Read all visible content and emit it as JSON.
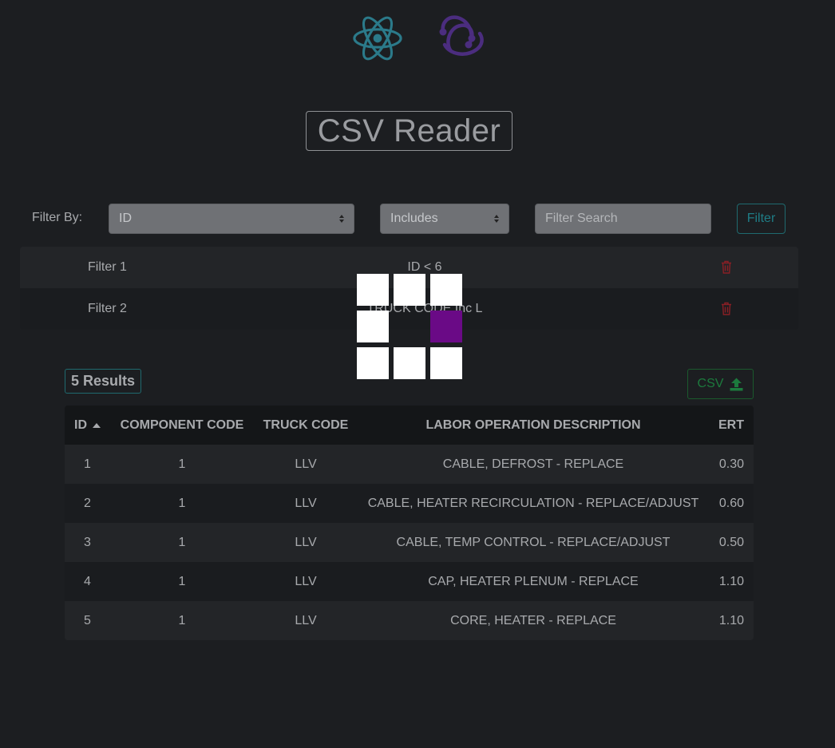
{
  "header": {
    "title": "CSV Reader",
    "logos": [
      "react-logo",
      "redux-logo"
    ]
  },
  "filter_bar": {
    "label": "Filter By:",
    "field_select": {
      "selected": "ID"
    },
    "operator_select": {
      "selected": "Includes"
    },
    "search": {
      "value": "",
      "placeholder": "Filter Search"
    },
    "button_label": "Filter"
  },
  "active_filters": [
    {
      "name": "Filter 1",
      "expression": "ID < 6"
    },
    {
      "name": "Filter 2",
      "expression": "TRUCK CODE Inc L"
    }
  ],
  "results": {
    "count_label": "5 Results",
    "csv_button_label": "CSV"
  },
  "table": {
    "columns": [
      "ID",
      "COMPONENT CODE",
      "TRUCK CODE",
      "LABOR OPERATION DESCRIPTION",
      "ERT"
    ],
    "sort": {
      "column": "ID",
      "direction": "ascending"
    },
    "rows": [
      [
        "1",
        "1",
        "LLV",
        "CABLE, DEFROST - REPLACE",
        "0.30"
      ],
      [
        "2",
        "1",
        "LLV",
        "CABLE, HEATER RECIRCULATION - REPLACE/ADJUST",
        "0.60"
      ],
      [
        "3",
        "1",
        "LLV",
        "CABLE, TEMP CONTROL - REPLACE/ADJUST",
        "0.50"
      ],
      [
        "4",
        "1",
        "LLV",
        "CAP, HEATER PLENUM - REPLACE",
        "1.10"
      ],
      [
        "5",
        "1",
        "LLV",
        "CORE, HEATER - REPLACE",
        "1.10"
      ]
    ]
  },
  "colors": {
    "background": "#1c1e21",
    "react_logo": "#2b7a8a",
    "redux_logo": "#4b2d7f",
    "delete_icon": "#8a1f25",
    "loader_active": "#6a0a86",
    "filter_button": "#1f7d86",
    "csv_button": "#1c7a3d"
  }
}
